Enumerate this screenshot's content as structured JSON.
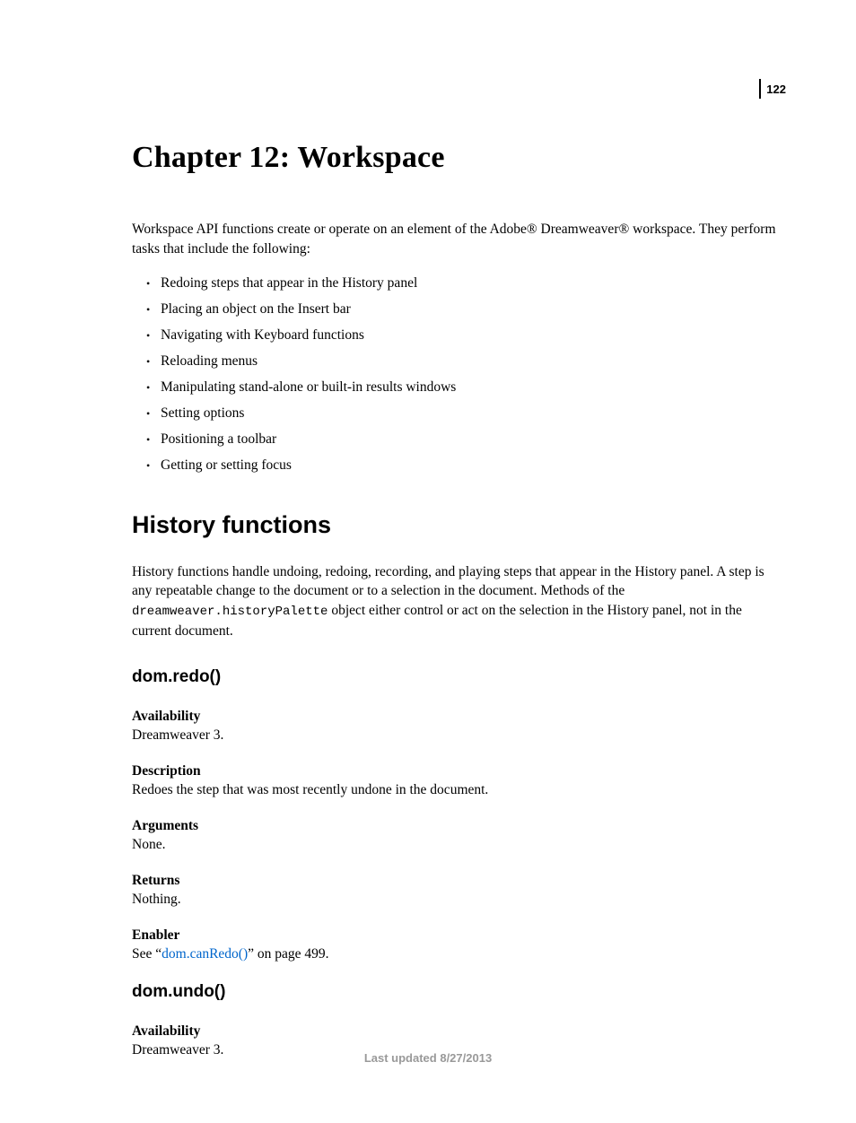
{
  "page_number": "122",
  "chapter_title": "Chapter 12: Workspace",
  "intro": "Workspace API functions create or operate on an element of the Adobe® Dreamweaver® workspace. They perform tasks that include the following:",
  "bullets": [
    "Redoing steps that appear in the History panel",
    "Placing an object on the Insert bar",
    "Navigating with Keyboard functions",
    "Reloading menus",
    "Manipulating stand-alone or built-in results windows",
    "Setting options",
    "Positioning a toolbar",
    "Getting or setting focus"
  ],
  "section_title": "History functions",
  "section_intro_pre": "History functions handle undoing, redoing, recording, and playing steps that appear in the History panel. A step is any repeatable change to the document or to a selection in the document. Methods of the ",
  "section_intro_code": "dreamweaver.historyPalette",
  "section_intro_post": " object either control or act on the selection in the History panel, not in the current document.",
  "methods": [
    {
      "name": "dom.redo()",
      "availability_label": "Availability",
      "availability": "Dreamweaver 3.",
      "description_label": "Description",
      "description": "Redoes the step that was most recently undone in the document.",
      "arguments_label": "Arguments",
      "arguments": "None.",
      "returns_label": "Returns",
      "returns": "Nothing.",
      "enabler_label": "Enabler",
      "enabler_pre": "See “",
      "enabler_link": "dom.canRedo()",
      "enabler_post": "” on page 499."
    },
    {
      "name": "dom.undo()",
      "availability_label": "Availability",
      "availability": "Dreamweaver 3."
    }
  ],
  "footer": "Last updated 8/27/2013"
}
